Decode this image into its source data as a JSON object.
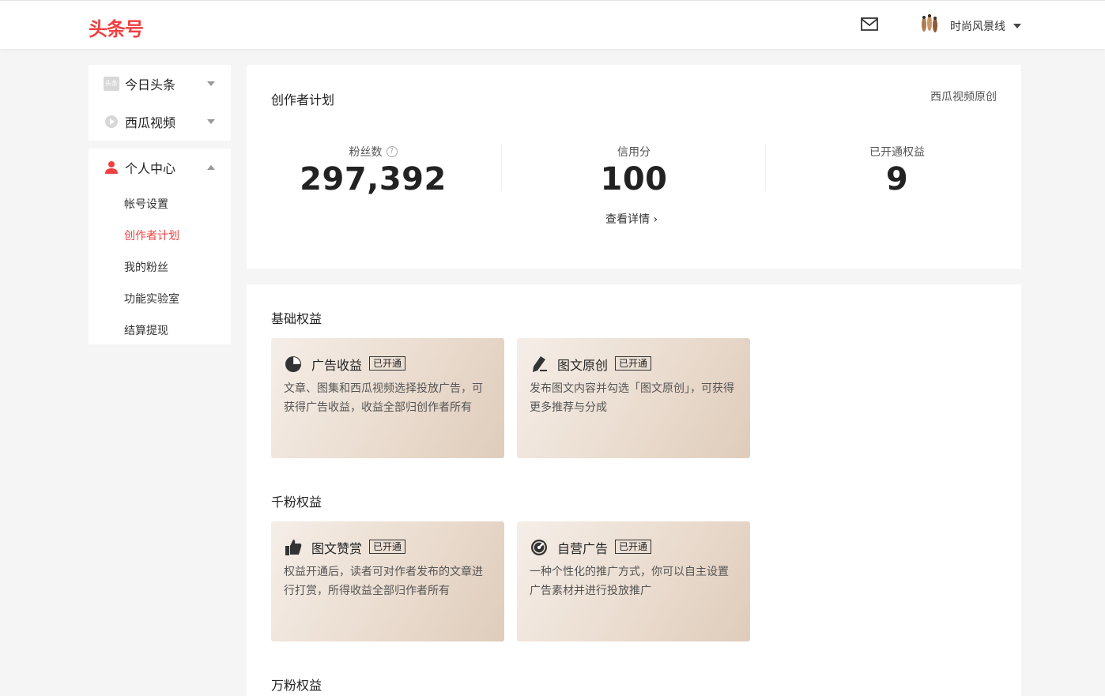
{
  "header": {
    "logo": "头条号",
    "mail_icon": "mail-icon",
    "username": "时尚风景线"
  },
  "sidebar": {
    "groups": [
      {
        "label": "今日头条",
        "icon": "toutiao-icon"
      },
      {
        "label": "西瓜视频",
        "icon": "xigua-icon"
      }
    ],
    "personal": {
      "label": "个人中心",
      "icon": "user-icon",
      "items": [
        "帐号设置",
        "创作者计划",
        "我的粉丝",
        "功能实验室",
        "结算提现"
      ],
      "active": "创作者计划"
    },
    "toutiao_icon_text": "头条"
  },
  "overview": {
    "title": "创作者计划",
    "link": "西瓜视频原创",
    "stats": [
      {
        "label": "粉丝数",
        "value": "297,392"
      },
      {
        "label": "信用分",
        "value": "100"
      },
      {
        "label": "已开通权益",
        "value": "9"
      }
    ],
    "help_glyph": "?",
    "detail_link": "查看详情 ›"
  },
  "sections": [
    {
      "title": "基础权益",
      "perks": [
        {
          "name": "广告收益",
          "badge": "已开通",
          "icon": "pie-chart-icon",
          "desc": "文章、图集和西瓜视频选择投放广告，可获得广告收益，收益全部归创作者所有"
        },
        {
          "name": "图文原创",
          "badge": "已开通",
          "icon": "pen-icon",
          "desc": "发布图文内容并勾选「图文原创」，可获得更多推荐与分成"
        }
      ]
    },
    {
      "title": "千粉权益",
      "perks": [
        {
          "name": "图文赞赏",
          "badge": "已开通",
          "icon": "thumbs-up-icon",
          "desc": "权益开通后，读者可对作者发布的文章进行打赏，所得收益全部归作者所有"
        },
        {
          "name": "自营广告",
          "badge": "已开通",
          "icon": "gauge-icon",
          "desc": "一种个性化的推广方式，你可以自主设置广告素材并进行投放推广"
        }
      ]
    },
    {
      "title": "万粉权益",
      "perks": []
    }
  ],
  "colors": {
    "brand": "#f04142",
    "accent_text": "#f04142"
  }
}
